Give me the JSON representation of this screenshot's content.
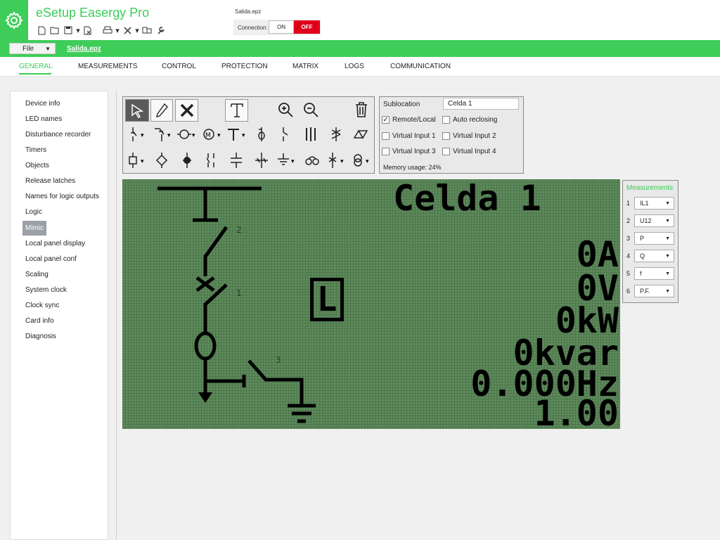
{
  "app": {
    "title": "eSetup Easergy Pro",
    "file_name": "Salida.epz"
  },
  "connection": {
    "label": "Connection:",
    "on": "ON",
    "off": "OFF",
    "state": "OFF"
  },
  "menu": {
    "file": "File",
    "file_link": "Salida.epz"
  },
  "tabs": [
    "GENERAL",
    "MEASUREMENTS",
    "CONTROL",
    "PROTECTION",
    "MATRIX",
    "LOGS",
    "COMMUNICATION"
  ],
  "active_tab": "GENERAL",
  "sidebar": {
    "items": [
      "Device info",
      "LED names",
      "Disturbance recorder",
      "Timers",
      "Objects",
      "Release latches",
      "Names for logic outputs",
      "Logic",
      "Mimic",
      "Local panel display",
      "Local panel conf",
      "Scaling",
      "System clock",
      "Clock sync",
      "Card info",
      "Diagnosis"
    ],
    "selected": "Mimic"
  },
  "toolbar": {
    "icons": [
      "pointer-icon",
      "pencil-icon",
      "delete-icon",
      "text-icon",
      "zoom-in-icon",
      "zoom-out-icon",
      "trash-icon",
      "disconnector-icon",
      "breaker-icon",
      "circle-icon",
      "motor-icon",
      "busbar-t-icon",
      "fuse-icon",
      "switch-icon",
      "vertical-bars-icon",
      "earth-switch-icon",
      "transformer-icon",
      "square-node-icon",
      "diamond-icon",
      "filled-node-icon",
      "contact-icon",
      "capacitor-icon",
      "cross-bar-icon",
      "ground-icon",
      "coupling-icon",
      "bus-tie-icon",
      "transformer-round-icon"
    ]
  },
  "sublocation": {
    "label": "Sublocation",
    "value": "Celda 1",
    "options": [
      {
        "label": "Remote/Local",
        "checked": true
      },
      {
        "label": "Auto reclosing",
        "checked": false
      },
      {
        "label": "Virtual Input 1",
        "checked": false
      },
      {
        "label": "Virtual Input 2",
        "checked": false
      },
      {
        "label": "Virtual Input 3",
        "checked": false
      },
      {
        "label": "Virtual Input 4",
        "checked": false
      }
    ],
    "memory_usage": "Memory usage: 24%"
  },
  "lcd": {
    "title": "Celda 1",
    "indicator": "L",
    "values": [
      "0A",
      "0V",
      "0kW",
      "0kvar",
      "0.000Hz",
      "1.00"
    ],
    "object_labels": [
      "2",
      "1",
      "3"
    ]
  },
  "measurements": {
    "title": "Measurements",
    "rows": [
      {
        "index": "1",
        "value": "IL1"
      },
      {
        "index": "2",
        "value": "U12"
      },
      {
        "index": "3",
        "value": "P"
      },
      {
        "index": "4",
        "value": "Q"
      },
      {
        "index": "5",
        "value": "f"
      },
      {
        "index": "6",
        "value": "P.F."
      }
    ]
  },
  "colors": {
    "brand_green": "#3dcd58",
    "off_red": "#e0001a",
    "lcd_green": "#5e8a5c"
  }
}
